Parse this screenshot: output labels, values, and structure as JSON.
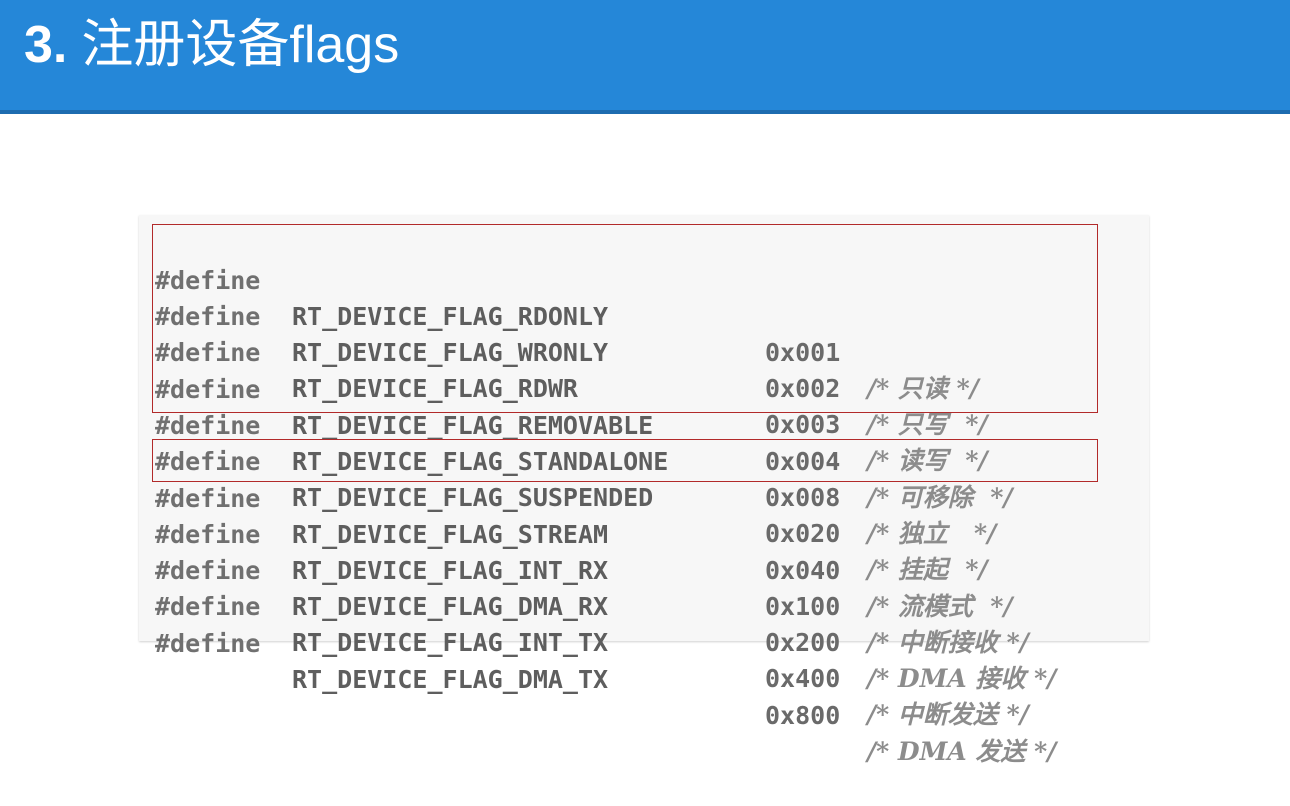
{
  "header": {
    "number": "3.",
    "title": "注册设备flags",
    "bg_color": "#2587d8"
  },
  "code": {
    "lines": [
      {
        "keyword": "#define",
        "name": "RT_DEVICE_FLAG_RDONLY",
        "value": "0x001",
        "comment": "/* 只读 */"
      },
      {
        "keyword": "#define",
        "name": "RT_DEVICE_FLAG_WRONLY",
        "value": "0x002",
        "comment": "/* 只写  */"
      },
      {
        "keyword": "#define",
        "name": "RT_DEVICE_FLAG_RDWR",
        "value": "0x003",
        "comment": "/* 读写  */"
      },
      {
        "keyword": "#define",
        "name": "RT_DEVICE_FLAG_REMOVABLE",
        "value": "0x004",
        "comment": "/* 可移除  */"
      },
      {
        "keyword": "#define",
        "name": "RT_DEVICE_FLAG_STANDALONE",
        "value": "0x008",
        "comment": "/* 独立   */"
      },
      {
        "keyword": "#define",
        "name": "RT_DEVICE_FLAG_SUSPENDED",
        "value": "0x020",
        "comment": "/* 挂起  */"
      },
      {
        "keyword": "#define",
        "name": "RT_DEVICE_FLAG_STREAM",
        "value": "0x040",
        "comment": "/* 流模式  */"
      },
      {
        "keyword": "#define",
        "name": "RT_DEVICE_FLAG_INT_RX",
        "value": "0x100",
        "comment": "/* 中断接收 */"
      },
      {
        "keyword": "#define",
        "name": "RT_DEVICE_FLAG_DMA_RX",
        "value": "0x200",
        "comment": "/* DMA 接收 */"
      },
      {
        "keyword": "#define",
        "name": "RT_DEVICE_FLAG_INT_TX",
        "value": "0x400",
        "comment": "/* 中断发送 */"
      },
      {
        "keyword": "#define",
        "name": "RT_DEVICE_FLAG_DMA_TX",
        "value": "0x800",
        "comment": "/* DMA 发送 */"
      }
    ],
    "highlight_color": "#b22a2a"
  }
}
